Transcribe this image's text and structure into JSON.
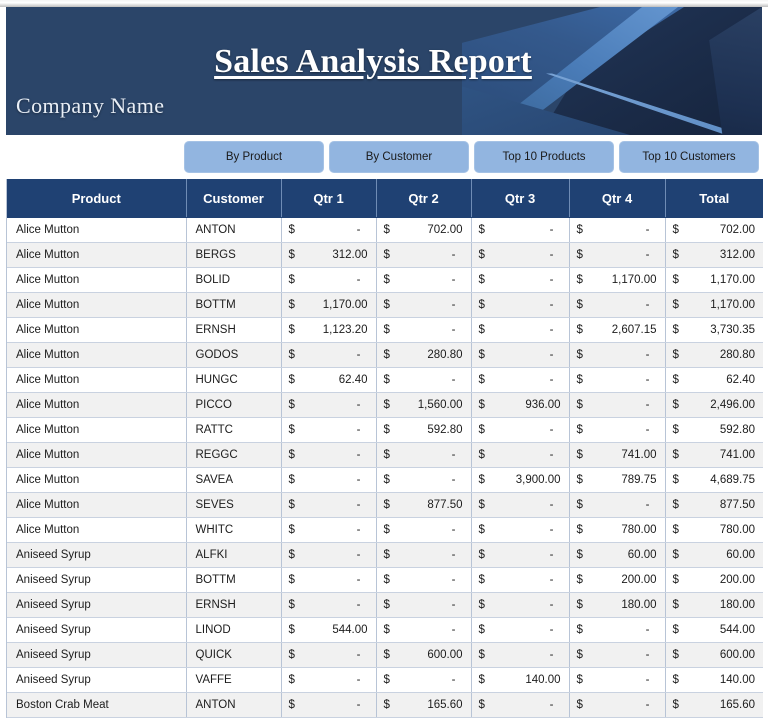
{
  "banner": {
    "report_title": "Sales Analysis Report",
    "company_name": "Company Name",
    "background_color": "#2b4569",
    "accent_color": "#4a7cb8"
  },
  "nav_buttons": [
    {
      "label": "By Product"
    },
    {
      "label": "By Customer"
    },
    {
      "label": "Top 10 Products"
    },
    {
      "label": "Top 10 Customers"
    }
  ],
  "button_color": "#92b5e0",
  "table": {
    "header_color": "#1f4173",
    "columns": [
      "Product",
      "Customer",
      "Qtr 1",
      "Qtr 2",
      "Qtr 3",
      "Qtr 4",
      "Total"
    ],
    "currency_symbol": "$",
    "blank_marker": "-",
    "rows": [
      {
        "product": "Alice Mutton",
        "customer": "ANTON",
        "qtr1": "-",
        "qtr2": "702.00",
        "qtr3": "-",
        "qtr4": "-",
        "total": "702.00"
      },
      {
        "product": "Alice Mutton",
        "customer": "BERGS",
        "qtr1": "312.00",
        "qtr2": "-",
        "qtr3": "-",
        "qtr4": "-",
        "total": "312.00"
      },
      {
        "product": "Alice Mutton",
        "customer": "BOLID",
        "qtr1": "-",
        "qtr2": "-",
        "qtr3": "-",
        "qtr4": "1,170.00",
        "total": "1,170.00"
      },
      {
        "product": "Alice Mutton",
        "customer": "BOTTM",
        "qtr1": "1,170.00",
        "qtr2": "-",
        "qtr3": "-",
        "qtr4": "-",
        "total": "1,170.00"
      },
      {
        "product": "Alice Mutton",
        "customer": "ERNSH",
        "qtr1": "1,123.20",
        "qtr2": "-",
        "qtr3": "-",
        "qtr4": "2,607.15",
        "total": "3,730.35"
      },
      {
        "product": "Alice Mutton",
        "customer": "GODOS",
        "qtr1": "-",
        "qtr2": "280.80",
        "qtr3": "-",
        "qtr4": "-",
        "total": "280.80"
      },
      {
        "product": "Alice Mutton",
        "customer": "HUNGC",
        "qtr1": "62.40",
        "qtr2": "-",
        "qtr3": "-",
        "qtr4": "-",
        "total": "62.40"
      },
      {
        "product": "Alice Mutton",
        "customer": "PICCO",
        "qtr1": "-",
        "qtr2": "1,560.00",
        "qtr3": "936.00",
        "qtr4": "-",
        "total": "2,496.00"
      },
      {
        "product": "Alice Mutton",
        "customer": "RATTC",
        "qtr1": "-",
        "qtr2": "592.80",
        "qtr3": "-",
        "qtr4": "-",
        "total": "592.80"
      },
      {
        "product": "Alice Mutton",
        "customer": "REGGC",
        "qtr1": "-",
        "qtr2": "-",
        "qtr3": "-",
        "qtr4": "741.00",
        "total": "741.00"
      },
      {
        "product": "Alice Mutton",
        "customer": "SAVEA",
        "qtr1": "-",
        "qtr2": "-",
        "qtr3": "3,900.00",
        "qtr4": "789.75",
        "total": "4,689.75"
      },
      {
        "product": "Alice Mutton",
        "customer": "SEVES",
        "qtr1": "-",
        "qtr2": "877.50",
        "qtr3": "-",
        "qtr4": "-",
        "total": "877.50"
      },
      {
        "product": "Alice Mutton",
        "customer": "WHITC",
        "qtr1": "-",
        "qtr2": "-",
        "qtr3": "-",
        "qtr4": "780.00",
        "total": "780.00"
      },
      {
        "product": "Aniseed Syrup",
        "customer": "ALFKI",
        "qtr1": "-",
        "qtr2": "-",
        "qtr3": "-",
        "qtr4": "60.00",
        "total": "60.00"
      },
      {
        "product": "Aniseed Syrup",
        "customer": "BOTTM",
        "qtr1": "-",
        "qtr2": "-",
        "qtr3": "-",
        "qtr4": "200.00",
        "total": "200.00"
      },
      {
        "product": "Aniseed Syrup",
        "customer": "ERNSH",
        "qtr1": "-",
        "qtr2": "-",
        "qtr3": "-",
        "qtr4": "180.00",
        "total": "180.00"
      },
      {
        "product": "Aniseed Syrup",
        "customer": "LINOD",
        "qtr1": "544.00",
        "qtr2": "-",
        "qtr3": "-",
        "qtr4": "-",
        "total": "544.00"
      },
      {
        "product": "Aniseed Syrup",
        "customer": "QUICK",
        "qtr1": "-",
        "qtr2": "600.00",
        "qtr3": "-",
        "qtr4": "-",
        "total": "600.00"
      },
      {
        "product": "Aniseed Syrup",
        "customer": "VAFFE",
        "qtr1": "-",
        "qtr2": "-",
        "qtr3": "140.00",
        "qtr4": "-",
        "total": "140.00"
      },
      {
        "product": "Boston Crab Meat",
        "customer": "ANTON",
        "qtr1": "-",
        "qtr2": "165.60",
        "qtr3": "-",
        "qtr4": "-",
        "total": "165.60"
      }
    ]
  }
}
